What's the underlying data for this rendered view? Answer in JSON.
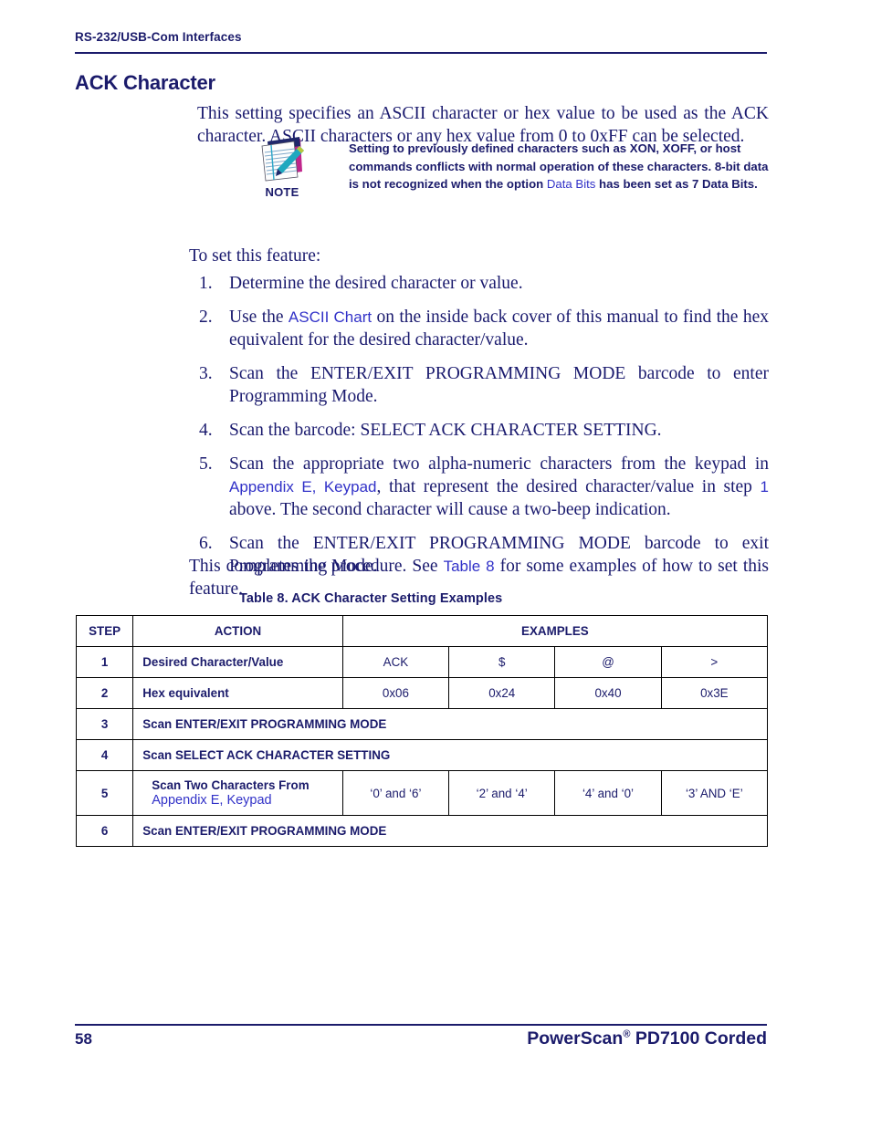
{
  "header": {
    "running_title": "RS-232/USB-Com Interfaces"
  },
  "section": {
    "title": "ACK Character",
    "intro_paragraph": "This setting specifies an ASCII character or hex value to be used as the ACK character. ASCII characters or any hex value from 0 to 0xFF can be selected."
  },
  "note": {
    "icon": "notepad-pen-icon",
    "label": "NOTE",
    "text_part1": "Setting to previously defined characters such as XON, XOFF, or host commands conflicts with normal operation of these characters. 8-bit data is not recognized when the option ",
    "link": "Data Bits",
    "text_part2": " has been set as 7 Data Bits."
  },
  "body": {
    "lead_in": "To set this feature:",
    "steps": [
      {
        "number": "1.",
        "text": "Determine the desired character or value."
      },
      {
        "number": "2.",
        "text_part1": "Use the ",
        "link": "ASCII Chart",
        "text_part2": " on the inside back cover of this manual to find the hex equivalent for the desired character/value."
      },
      {
        "number": "3.",
        "text": "Scan the ENTER/EXIT PROGRAMMING MODE barcode to enter Programming Mode."
      },
      {
        "number": "4.",
        "text": "Scan the barcode: SELECT ACK CHARACTER SETTING."
      },
      {
        "number": "5.",
        "text_part1": "Scan the appropriate two alpha-numeric characters from the keypad in ",
        "link": "Appendix E, Keypad",
        "text_part2": ", that represent the desired character/value in step ",
        "link2": "1",
        "text_part3": " above. The second character will cause a two-beep indication."
      },
      {
        "number": "6.",
        "text": "Scan the ENTER/EXIT PROGRAMMING MODE barcode to exit Programming Mode."
      }
    ],
    "closing_part1": "This completes the procedure. See ",
    "closing_link": "Table 8",
    "closing_part2": " for some examples of how to set this feature."
  },
  "table": {
    "caption": "Table 8. ACK Character Setting Examples",
    "headers": {
      "step": "STEP",
      "action": "ACTION",
      "examples": "EXAMPLES"
    },
    "rows": [
      {
        "step": "1",
        "action": "Desired Character/Value",
        "examples": [
          "ACK",
          "$",
          "@",
          ">"
        ]
      },
      {
        "step": "2",
        "action": "Hex equivalent",
        "examples": [
          "0x06",
          "0x24",
          "0x40",
          "0x3E"
        ]
      },
      {
        "step": "3",
        "action": "Scan ENTER/EXIT PROGRAMMING MODE",
        "span": true
      },
      {
        "step": "4",
        "action": "Scan SELECT ACK CHARACTER SETTING",
        "span": true
      },
      {
        "step": "5",
        "action": "Scan Two Characters From",
        "action_link": "Appendix E, Keypad",
        "examples": [
          "‘0’ and ‘6’",
          "‘2’ and ‘4’",
          "‘4’ and ‘0’",
          "‘3’ AND ‘E’"
        ]
      },
      {
        "step": "6",
        "action": "Scan ENTER/EXIT PROGRAMMING MODE",
        "span": true
      }
    ]
  },
  "footer": {
    "page_number": "58",
    "product_name": "PowerScan",
    "product_mark": "®",
    "product_model": " PD7100 Corded"
  },
  "colors": {
    "body_navy": "#1a1a6e",
    "heading_navy": "#1b1b6b",
    "link_blue": "#3232c8",
    "rule_black": "#000000"
  }
}
